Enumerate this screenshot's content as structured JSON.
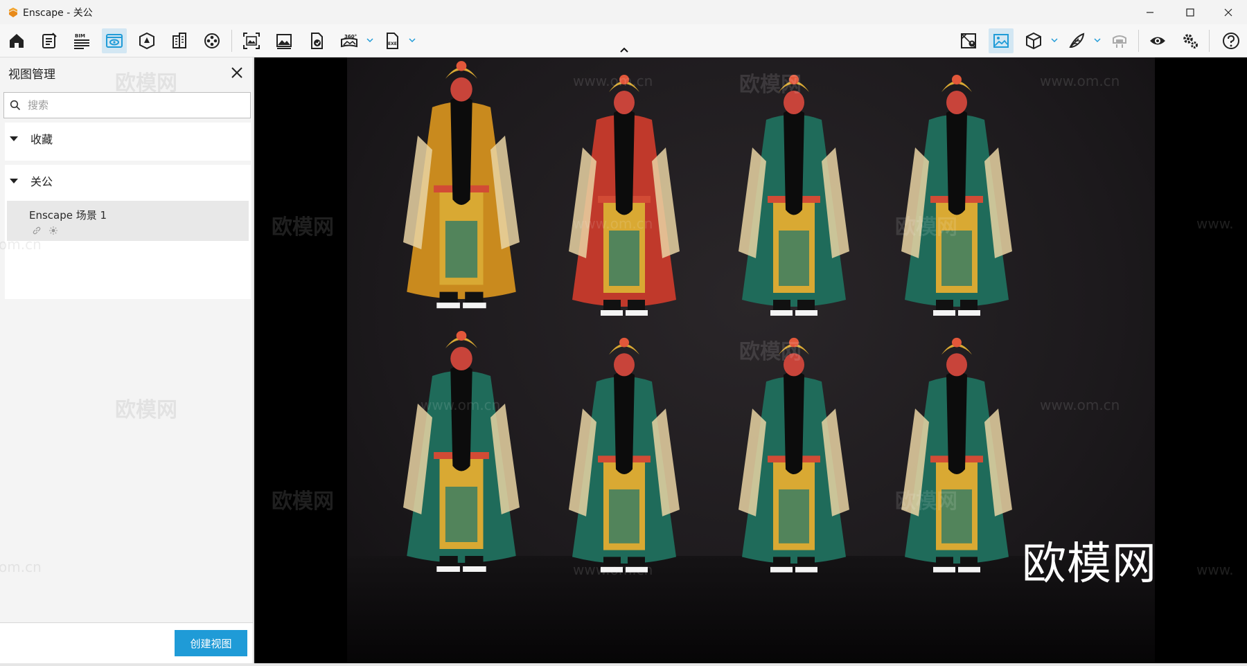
{
  "window": {
    "title": "Enscape - 关公",
    "controls": [
      "minimize-icon",
      "maximize-icon",
      "close-icon"
    ]
  },
  "toolbar": {
    "left_tools": [
      {
        "name": "home-icon"
      },
      {
        "name": "notes-icon"
      },
      {
        "name": "bim-icon",
        "label": "BIM"
      },
      {
        "name": "views-icon",
        "active": true
      },
      {
        "name": "assets-icon"
      },
      {
        "name": "building-icon"
      },
      {
        "name": "video-icon"
      },
      {
        "name": "screenshot-icon"
      },
      {
        "name": "image-icon"
      },
      {
        "name": "export-icon"
      },
      {
        "name": "panorama-icon",
        "label": "360°"
      },
      {
        "name": "exe-icon",
        "label": "EXE"
      }
    ],
    "right_tools": [
      {
        "name": "map-icon"
      },
      {
        "name": "atmosphere-icon"
      },
      {
        "name": "cube-icon"
      },
      {
        "name": "feather-icon"
      },
      {
        "name": "vr-headset-icon"
      },
      {
        "name": "eye-icon"
      },
      {
        "name": "settings-icon"
      },
      {
        "name": "help-icon"
      }
    ],
    "accent": "#1f9bd7"
  },
  "panel": {
    "title": "视图管理",
    "search": {
      "placeholder": "搜索",
      "value": ""
    },
    "sections": [
      {
        "label": "收藏",
        "expanded": true,
        "items": []
      },
      {
        "label": "关公",
        "expanded": true,
        "items": [
          {
            "name": "Enscape 场景 1"
          }
        ]
      }
    ],
    "create_button": "创建视图"
  },
  "viewport": {
    "watermark_text": "欧模网",
    "watermark_url": "www.om.cn",
    "watermark_partial": "om.cn",
    "watermark_partial_url": "www.",
    "big_watermark": "欧模网"
  }
}
